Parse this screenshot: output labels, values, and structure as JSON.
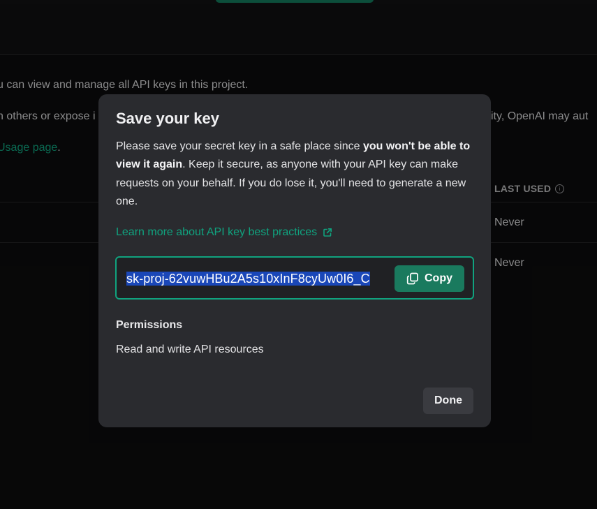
{
  "background": {
    "line1": "u can view and manage all API keys in this project.",
    "line2_left": "n others or expose i",
    "line2_right": "ity, OpenAI may aut",
    "line3_link": "Usage page",
    "line3_tail": ".",
    "column_header": "LAST USED",
    "info_glyph": "i",
    "rows": [
      "Never",
      "Never"
    ]
  },
  "modal": {
    "title": "Save your key",
    "desc_part1": "Please save your secret key in a safe place since ",
    "desc_bold": "you won't be able to view it again",
    "desc_part2": ". Keep it secure, as anyone with your API key can make requests on your behalf. If you do lose it, you'll need to generate a new one.",
    "link_label": "Learn more about API key best practices",
    "link_icon": "external-link-icon",
    "key_value": "sk-proj-62vuwHBu2A5s10xInF8cyUw0I6_C",
    "copy_label": "Copy",
    "copy_icon": "copy-icon",
    "permissions_label": "Permissions",
    "permissions_value": "Read and write API resources",
    "done_label": "Done"
  },
  "colors": {
    "accent": "#10a37f",
    "selection": "#1a47b8",
    "modal_bg": "#2a2b2f"
  }
}
